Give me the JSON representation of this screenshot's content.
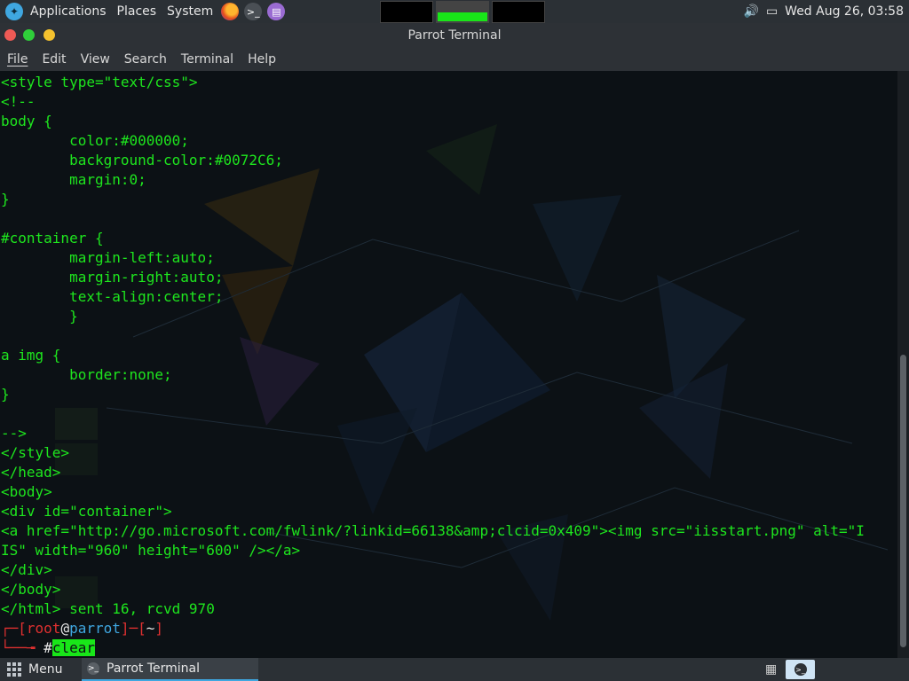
{
  "top_panel": {
    "applications": "Applications",
    "places": "Places",
    "system": "System",
    "clock": "Wed Aug 26, 03:58"
  },
  "window": {
    "title": "Parrot Terminal",
    "menu": [
      "File",
      "Edit",
      "View",
      "Search",
      "Terminal",
      "Help"
    ]
  },
  "terminal": {
    "lines": [
      "<style type=\"text/css\">",
      "<!--",
      "body {",
      "        color:#000000;",
      "        background-color:#0072C6;",
      "        margin:0;",
      "}",
      "",
      "#container {",
      "        margin-left:auto;",
      "        margin-right:auto;",
      "        text-align:center;",
      "        }",
      "",
      "a img {",
      "        border:none;",
      "}",
      "",
      "-->",
      "</style>",
      "</head>",
      "<body>",
      "<div id=\"container\">",
      "<a href=\"http://go.microsoft.com/fwlink/?linkid=66138&amp;clcid=0x409\"><img src=\"iisstart.png\" alt=\"I",
      "IS\" width=\"960\" height=\"600\" /></a>",
      "</div>",
      "</body>",
      "</html> sent 16, rcvd 970"
    ],
    "prompt": {
      "corner_top": "┌─[",
      "user": "root",
      "at": "@",
      "host": "parrot",
      "mid": "]─[",
      "dir": "~",
      "end": "]",
      "corner_bottom": "└──╼ ",
      "symbol": "#",
      "command": "clear"
    }
  },
  "bottom_panel": {
    "menu": "Menu",
    "task": "Parrot Terminal"
  }
}
